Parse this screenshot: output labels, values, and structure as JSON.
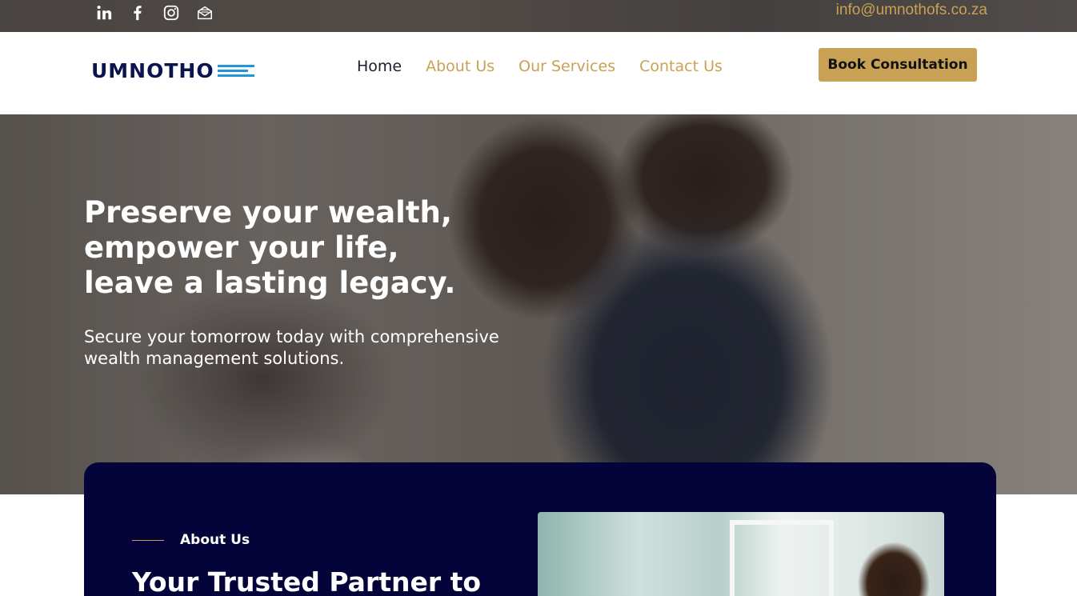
{
  "topbar": {
    "social": [
      {
        "name": "linkedin-icon",
        "glyph": "in"
      },
      {
        "name": "facebook-icon",
        "glyph": "f"
      },
      {
        "name": "instagram-icon",
        "glyph": "ig"
      },
      {
        "name": "mail-icon",
        "glyph": "mail"
      }
    ],
    "email": "info@umnothofs.co.za"
  },
  "header": {
    "logo_text": "UMNOTHO",
    "nav": [
      {
        "label": "Home",
        "active": true
      },
      {
        "label": "About Us",
        "active": false
      },
      {
        "label": "Our Services",
        "active": false
      },
      {
        "label": "Contact Us",
        "active": false
      }
    ],
    "cta_label": "Book Consultation"
  },
  "hero": {
    "title_lines": [
      "Preserve your wealth,",
      "empower your life,",
      "leave a lasting legacy."
    ],
    "subtitle": "Secure your tomorrow today with comprehensive wealth management solutions."
  },
  "about": {
    "eyebrow": "About Us",
    "heading": "Your Trusted Partner to"
  },
  "colors": {
    "accent": "#c9a154",
    "navy": "#04043a",
    "logo_blue": "#2196d8",
    "logo_dark": "#0c1450"
  }
}
